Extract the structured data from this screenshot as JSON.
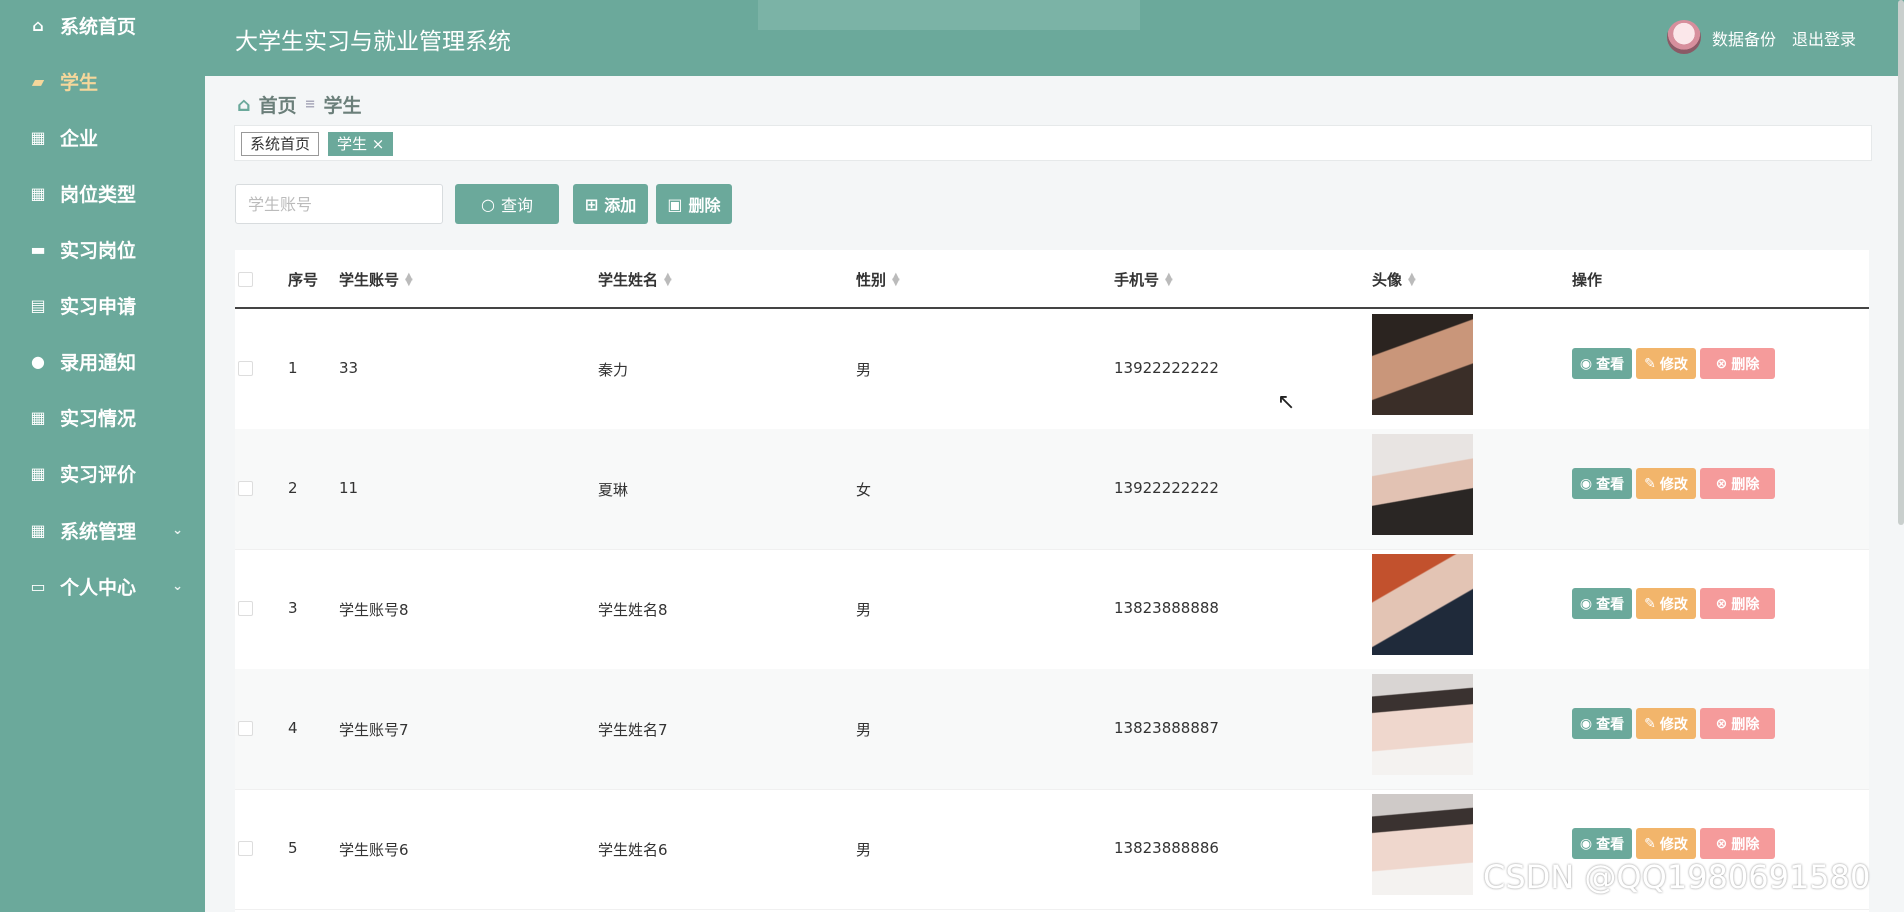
{
  "header": {
    "title": "大学生实习与就业管理系统",
    "backup": "数据备份",
    "logout": "退出登录"
  },
  "sidebar": {
    "items": [
      {
        "label": "系统首页",
        "icon": "home-icon"
      },
      {
        "label": "学生",
        "icon": "briefcase-icon",
        "active": true
      },
      {
        "label": "企业",
        "icon": "grid-icon"
      },
      {
        "label": "岗位类型",
        "icon": "grid-icon"
      },
      {
        "label": "实习岗位",
        "icon": "monitor-icon"
      },
      {
        "label": "实习申请",
        "icon": "clipboard-icon"
      },
      {
        "label": "录用通知",
        "icon": "bulb-icon"
      },
      {
        "label": "实习情况",
        "icon": "grid-icon"
      },
      {
        "label": "实习评价",
        "icon": "grid-icon"
      },
      {
        "label": "系统管理",
        "icon": "grid-icon",
        "expandable": true
      },
      {
        "label": "个人中心",
        "icon": "card-icon",
        "expandable": true
      }
    ]
  },
  "breadcrumb": {
    "home": "首页",
    "current": "学生"
  },
  "tags": {
    "home": "系统首页",
    "student": "学生"
  },
  "search": {
    "placeholder": "学生账号"
  },
  "buttons": {
    "query": "查询",
    "add": "添加",
    "delete": "删除"
  },
  "table": {
    "headers": {
      "index": "序号",
      "account": "学生账号",
      "name": "学生姓名",
      "gender": "性别",
      "phone": "手机号",
      "avatar": "头像",
      "ops": "操作"
    },
    "actions": {
      "view": "查看",
      "edit": "修改",
      "delete": "删除"
    },
    "rows": [
      {
        "index": "1",
        "account": "33",
        "name": "秦力",
        "gender": "男",
        "phone": "13922222222"
      },
      {
        "index": "2",
        "account": "11",
        "name": "夏琳",
        "gender": "女",
        "phone": "13922222222"
      },
      {
        "index": "3",
        "account": "学生账号8",
        "name": "学生姓名8",
        "gender": "男",
        "phone": "13823888888"
      },
      {
        "index": "4",
        "account": "学生账号7",
        "name": "学生姓名7",
        "gender": "男",
        "phone": "13823888887"
      },
      {
        "index": "5",
        "account": "学生账号6",
        "name": "学生姓名6",
        "gender": "男",
        "phone": "13823888886"
      }
    ]
  },
  "watermark": "CSDN @QQ1980691580",
  "colors": {
    "accent": "#6ba99b",
    "edit": "#f2b56b",
    "delete": "#f59b9b",
    "active_nav": "#f5d79b"
  }
}
